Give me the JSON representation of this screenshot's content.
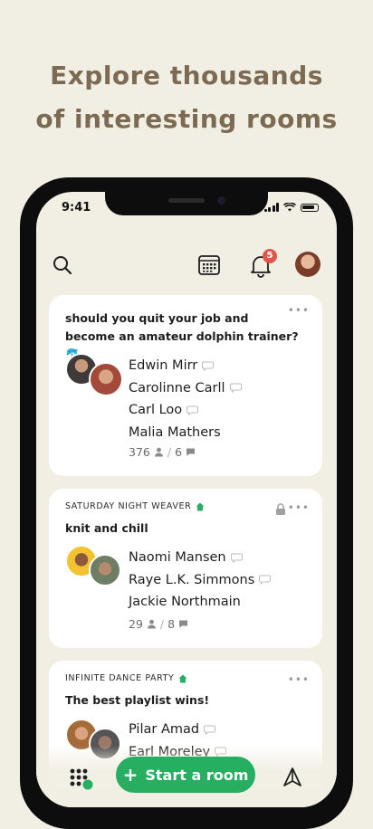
{
  "headline": {
    "line1": "Explore thousands",
    "line2": "of interesting rooms"
  },
  "status_bar": {
    "time": "9:41"
  },
  "topbar": {
    "notification_count": "5"
  },
  "rooms": [
    {
      "club": "",
      "title": "should you quit your job and become an amateur dolphin trainer? 🐬",
      "speakers": [
        "Edwin Mirr",
        "Carolinne Carll",
        "Carl Loo",
        "Malia Mathers"
      ],
      "listeners": "376",
      "speaker_count": "6",
      "locked": false
    },
    {
      "club": "SATURDAY NIGHT WEAVER",
      "title": "knit and chill",
      "speakers": [
        "Naomi Mansen",
        "Raye L.K. Simmons",
        "Jackie Northmain"
      ],
      "listeners": "29",
      "speaker_count": "8",
      "locked": true
    },
    {
      "club": "INFINITE DANCE PARTY",
      "title": "The best playlist wins!",
      "speakers": [
        "Pilar Amad",
        "Earl Moreley"
      ],
      "locked": false
    }
  ],
  "bottom_bar": {
    "start_room_label": "Start a room"
  },
  "colors": {
    "accent_green": "#27ae60",
    "headline": "#7c6a52",
    "background": "#f1efe4",
    "badge": "#e1554b"
  }
}
